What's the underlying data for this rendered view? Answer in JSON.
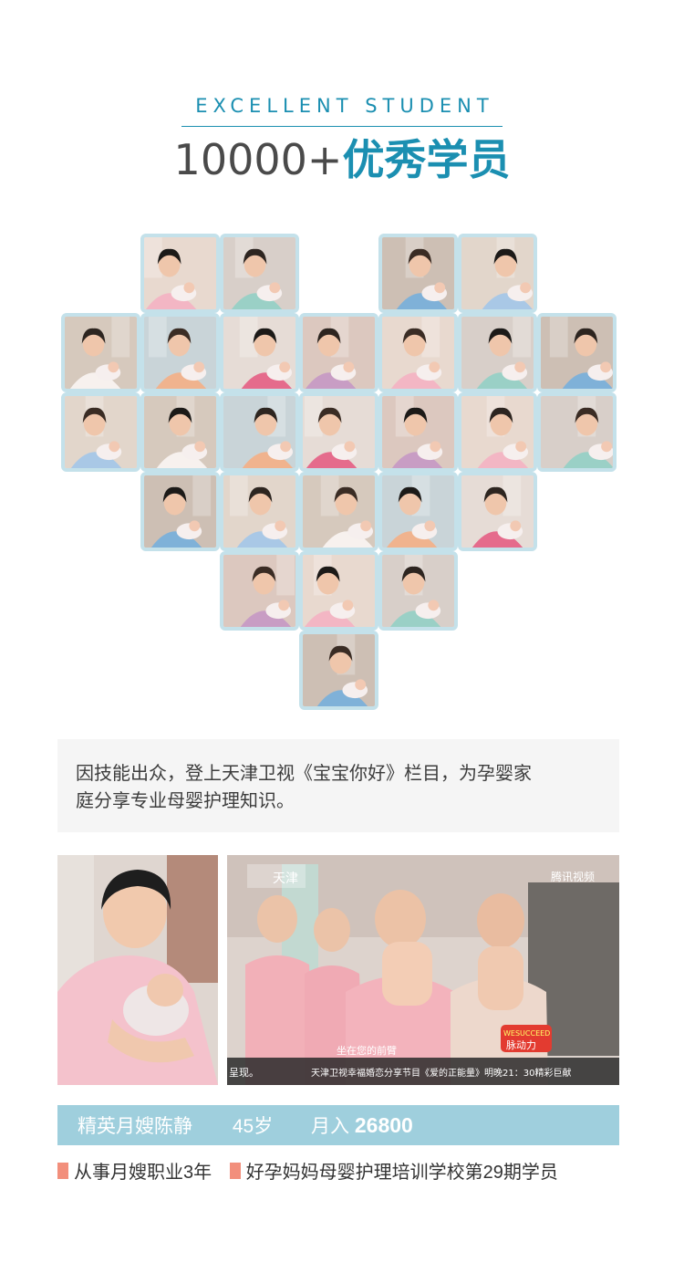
{
  "header": {
    "subtitle": "EXCELLENT STUDENT",
    "count": "10000+",
    "title": "优秀学员"
  },
  "description": {
    "line1": "因技能出众，登上天津卫视《宝宝你好》栏目，为孕婴家",
    "line2": "庭分享专业母婴护理知识。"
  },
  "tv_screenshot": {
    "channel_logo_text": "天津",
    "watermark": "腾讯视频",
    "subtitle": "坐在您的前臂",
    "ticker_left": "呈现。",
    "ticker": "天津卫视幸福婚恋分享节目《爱的正能量》明晚21：30精彩巨献",
    "sponsor_badge": "WESUCCEED",
    "sponsor_text": "脉动力"
  },
  "profile": {
    "name": "精英月嫂陈静",
    "age": "45岁",
    "income_label": "月入",
    "income_value": "26800"
  },
  "tags": [
    "从事月嫂职业3年",
    "好孕妈妈母婴护理培训学校第29期学员"
  ],
  "colors": {
    "accent": "#1b8fb1",
    "tile_border": "#c4e1ea",
    "info_bar": "#9fcfdd",
    "tag_marker": "#f28f7c"
  }
}
